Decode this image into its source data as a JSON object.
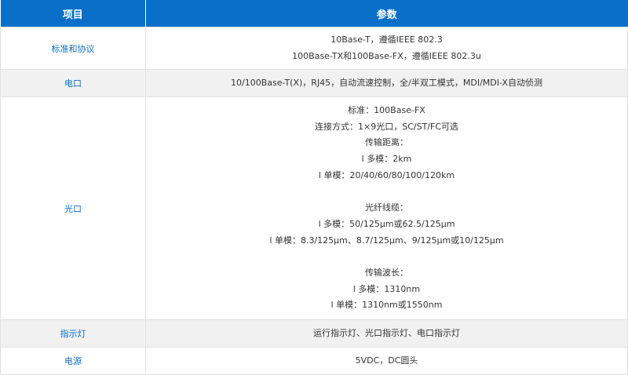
{
  "header": {
    "col_item": "项目",
    "col_param": "参数"
  },
  "rows": [
    {
      "label": "标准和协议",
      "shaded": false,
      "height": 54,
      "lines": [
        "10Base-T，遵循IEEE 802.3",
        "100Base-TX和100Base-FX，遵循IEEE 802.3u"
      ]
    },
    {
      "label": "电口",
      "shaded": true,
      "height": 35,
      "lines": [
        "10/100Base-T(X)，RJ45，自动流速控制，全/半双工模式，MDI/MDI-X自动侦测"
      ]
    },
    {
      "label": "光口",
      "shaded": false,
      "height": 284,
      "lines": [
        "标准：100Base-FX",
        "连接方式：1×9光口，SC/ST/FC可选",
        "传输距离：",
        "l 多模：2km",
        "l 单模：20/40/60/80/100/120km",
        "",
        "光纤线缆：",
        "l 多模：50/125μm或62.5/125μm",
        "l 单模：8.3/125μm、8.7/125μm、9/125μm或10/125μm",
        "",
        "传输波长：",
        "l 多模：1310nm",
        "l 单模：1310nm或1550nm"
      ]
    },
    {
      "label": "指示灯",
      "shaded": true,
      "height": 35,
      "lines": [
        "运行指示灯、光口指示灯、电口指示灯"
      ]
    },
    {
      "label": "电源",
      "shaded": false,
      "height": 35,
      "lines": [
        "5VDC，DC圆头"
      ]
    }
  ]
}
